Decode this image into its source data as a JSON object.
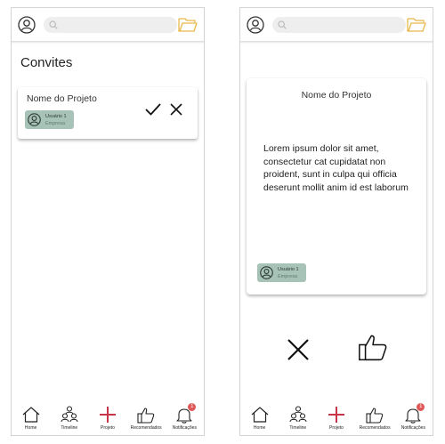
{
  "search": {
    "placeholder": ""
  },
  "invites_screen": {
    "title": "Convites",
    "invite": {
      "project_name": "Nome do Projeto",
      "user_name": "Usuário 1",
      "user_role": "Empresa"
    }
  },
  "detail_screen": {
    "project_name": "Nome do Projeto",
    "description": "Lorem ipsum dolor sit amet, consectetur cat cupidatat non proident, sunt in culpa qui officia deserunt mollit anim id est laborum",
    "user_name": "Usuário 1",
    "user_role": "Empresa"
  },
  "nav": {
    "home": "Home",
    "timeline": "Timeline",
    "projeto": "Projeto",
    "recomendados": "Recomendados",
    "notificacoes": "Notificações",
    "badge_count": "1"
  },
  "colors": {
    "accent_red": "#c8344a",
    "chip_green": "#a7c2b7",
    "folder_yellow": "#e8b84a",
    "badge_red": "#e05757"
  },
  "icons": [
    "user-circle-icon",
    "search-icon",
    "folder-icon",
    "check-icon",
    "close-icon",
    "thumbs-up-icon",
    "home-icon",
    "timeline-icon",
    "plus-icon",
    "bell-icon"
  ]
}
